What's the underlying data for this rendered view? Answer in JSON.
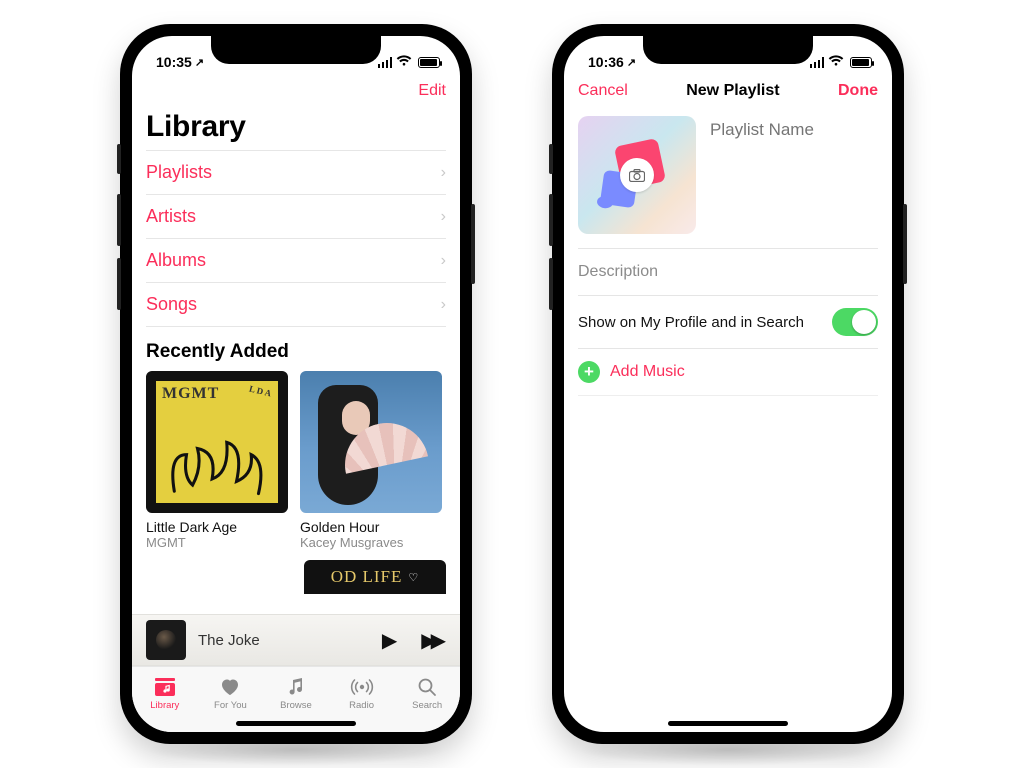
{
  "status": {
    "time": "10:35",
    "loc_arrow": "↗"
  },
  "left": {
    "nav": {
      "edit": "Edit"
    },
    "title": "Library",
    "rows": [
      {
        "label": "Playlists"
      },
      {
        "label": "Artists"
      },
      {
        "label": "Albums"
      },
      {
        "label": "Songs"
      }
    ],
    "recently_added": "Recently Added",
    "albums": [
      {
        "title": "Little Dark Age",
        "artist": "MGMT",
        "cover_text_tl": "MGMT",
        "cover_text_tr": "L\nD\nA"
      },
      {
        "title": "Golden Hour",
        "artist": "Kacey Musgraves"
      }
    ],
    "peek_cover_text": "OD LIFE",
    "nowplaying": {
      "title": "The Joke"
    },
    "tabs": [
      {
        "id": "library",
        "label": "Library",
        "active": true
      },
      {
        "id": "foryou",
        "label": "For You"
      },
      {
        "id": "browse",
        "label": "Browse"
      },
      {
        "id": "radio",
        "label": "Radio"
      },
      {
        "id": "search",
        "label": "Search"
      }
    ]
  },
  "right": {
    "nav": {
      "cancel": "Cancel",
      "title": "New Playlist",
      "done": "Done"
    },
    "name_placeholder": "Playlist Name",
    "description_placeholder": "Description",
    "toggle_label": "Show on My Profile and in Search",
    "toggle_on": true,
    "add_music": "Add Music"
  },
  "status2": {
    "time": "10:36",
    "loc_arrow": "↗"
  }
}
